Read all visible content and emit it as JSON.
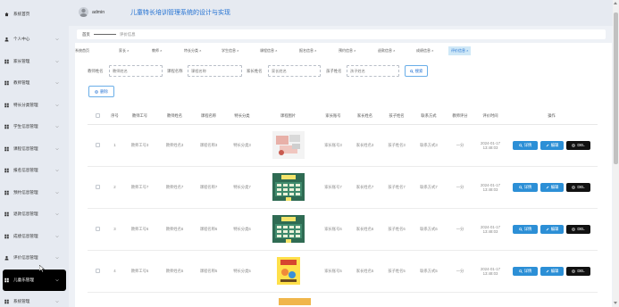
{
  "header": {
    "username": "admin",
    "system_title": "儿童特长培训管理系统的设计与实现"
  },
  "sidebar": {
    "items": [
      {
        "label": "系统首页",
        "icon": "home-icon"
      },
      {
        "label": "个人中心",
        "icon": "user-icon"
      },
      {
        "label": "家长管理",
        "icon": "grid-icon"
      },
      {
        "label": "教师管理",
        "icon": "grid-icon"
      },
      {
        "label": "特长分类管理",
        "icon": "grid-icon"
      },
      {
        "label": "学生信息管理",
        "icon": "grid-icon"
      },
      {
        "label": "课程信息管理",
        "icon": "grid-icon"
      },
      {
        "label": "报名信息管理",
        "icon": "grid-icon"
      },
      {
        "label": "预约信息管理",
        "icon": "grid-icon"
      },
      {
        "label": "退款信息管理",
        "icon": "grid-icon"
      },
      {
        "label": "成绩信息管理",
        "icon": "grid-icon"
      },
      {
        "label": "评价信息管理",
        "icon": "user-icon"
      },
      {
        "label": "儿童乐管理",
        "icon": "grid-icon"
      },
      {
        "label": "系统管理",
        "icon": "grid-icon"
      }
    ],
    "active_index": 12
  },
  "breadcrumb": {
    "home": "首页",
    "current": "评价信息"
  },
  "tabs": [
    {
      "label": "系统首页"
    },
    {
      "label": "家长 ×"
    },
    {
      "label": "教师 ×"
    },
    {
      "label": "特长分类 ×"
    },
    {
      "label": "学生信息 ×"
    },
    {
      "label": "课程信息 ×"
    },
    {
      "label": "报名信息 ×"
    },
    {
      "label": "预约信息 ×"
    },
    {
      "label": "退款信息 ×"
    },
    {
      "label": "成绩信息 ×"
    },
    {
      "label": "评价信息 ×"
    }
  ],
  "filters": {
    "teacher_name_label": "教师姓名",
    "teacher_name_placeholder": "教师姓名",
    "course_name_label": "课程名称",
    "course_name_placeholder": "课程名称",
    "parent_name_label": "家长姓名",
    "parent_name_placeholder": "家长姓名",
    "child_name_label": "孩子姓名",
    "child_name_placeholder": "孩子姓名",
    "search_label": "搜索"
  },
  "actions": {
    "delete_label": "删除"
  },
  "table": {
    "headers": [
      "",
      "序号",
      "教师工号",
      "教师姓名",
      "课程名称",
      "特长分类",
      "课程图片",
      "家长账号",
      "家长姓名",
      "孩子姓名",
      "联系方式",
      "教师评分",
      "评价时间",
      "操作"
    ],
    "rows": [
      {
        "index": "1",
        "teacher_no": "教师工号3",
        "teacher_name": "教师姓名3",
        "course": "课程名称3",
        "category": "特长分类3",
        "parent_account": "家长账号3",
        "parent_name": "家长姓名3",
        "child_name": "孩子姓名3",
        "contact": "联系方式3",
        "score": "一分",
        "time": "2024-01-17 13:48:03"
      },
      {
        "index": "2",
        "teacher_no": "教师工号7",
        "teacher_name": "教师姓名7",
        "course": "课程名称7",
        "category": "特长分类7",
        "parent_account": "家长账号7",
        "parent_name": "家长姓名7",
        "child_name": "孩子姓名7",
        "contact": "联系方式7",
        "score": "一分",
        "time": "2024-01-17 13:48:03"
      },
      {
        "index": "3",
        "teacher_no": "教师工号6",
        "teacher_name": "教师姓名6",
        "course": "课程名称6",
        "category": "特长分类6",
        "parent_account": "家长账号6",
        "parent_name": "家长姓名6",
        "child_name": "孩子姓名6",
        "contact": "联系方式6",
        "score": "一分",
        "time": "2024-01-17 13:48:03"
      },
      {
        "index": "4",
        "teacher_no": "教师工号5",
        "teacher_name": "教师姓名5",
        "course": "课程名称5",
        "category": "特长分类5",
        "parent_account": "家长账号5",
        "parent_name": "家长姓名5",
        "child_name": "孩子姓名5",
        "contact": "联系方式5",
        "score": "一分",
        "time": "2024-01-17 13:48:03"
      }
    ],
    "op_detail": "详情",
    "op_edit": "编辑",
    "op_delete": "DEL"
  }
}
